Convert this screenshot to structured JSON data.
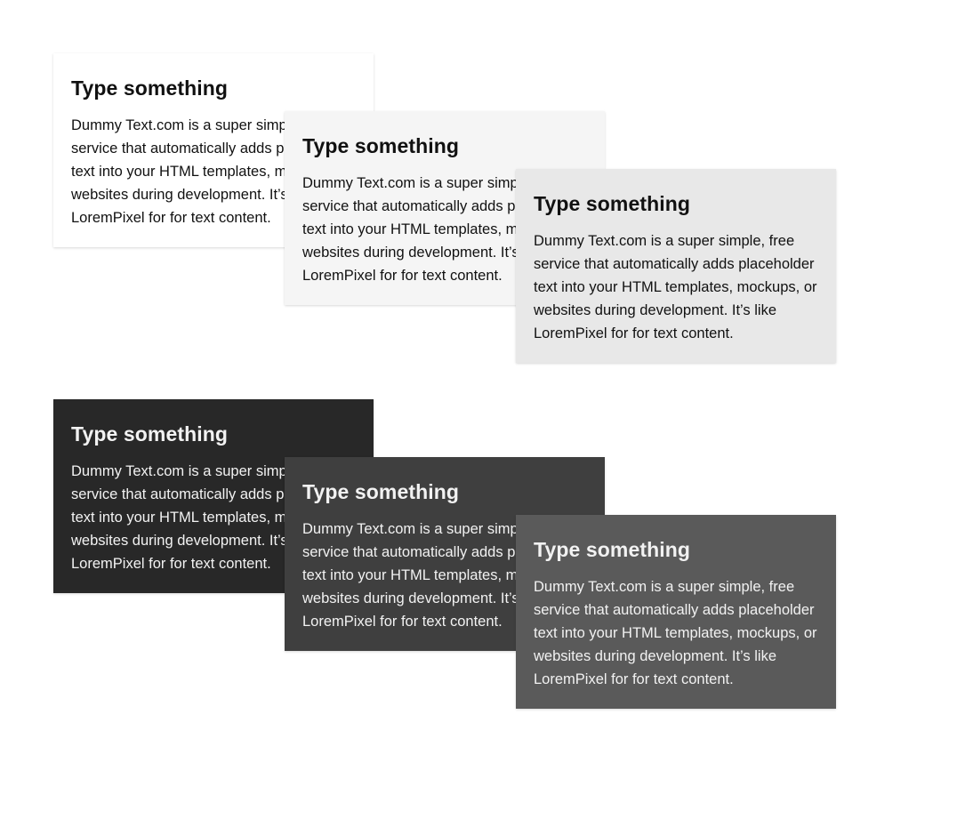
{
  "colors": {
    "card_light_1": "#ffffff",
    "card_light_2": "#f5f5f5",
    "card_light_3": "#e8e8e8",
    "card_dark_1": "#282828",
    "card_dark_2": "#3f3f3f",
    "card_dark_3": "#5a5a5a"
  },
  "light_cards": [
    {
      "title": "Type something",
      "body": "Dummy Text.com is a super simple, free service that automatically adds placeholder text into your HTML templates, mockups, or websites during development. It’s like LoremPixel for for text content."
    },
    {
      "title": "Type something",
      "body": "Dummy Text.com is a super simple, free service that automatically adds placeholder text into your HTML templates, mockups, or websites during development. It’s like LoremPixel for for text content."
    },
    {
      "title": "Type something",
      "body": "Dummy Text.com is a super simple, free service that automatically adds placeholder text into your HTML templates, mockups, or websites during development. It’s like LoremPixel for for text content."
    }
  ],
  "dark_cards": [
    {
      "title": "Type something",
      "body": "Dummy Text.com is a super simple, free service that automatically adds placeholder text into your HTML templates, mockups, or websites during development. It’s like LoremPixel for for text content."
    },
    {
      "title": "Type something",
      "body": "Dummy Text.com is a super simple, free service that automatically adds placeholder text into your HTML templates, mockups, or websites during development. It’s like LoremPixel for for text content."
    },
    {
      "title": "Type something",
      "body": "Dummy Text.com is a super simple, free service that automatically adds placeholder text into your HTML templates, mockups, or websites during development. It’s like LoremPixel for for text content."
    }
  ]
}
